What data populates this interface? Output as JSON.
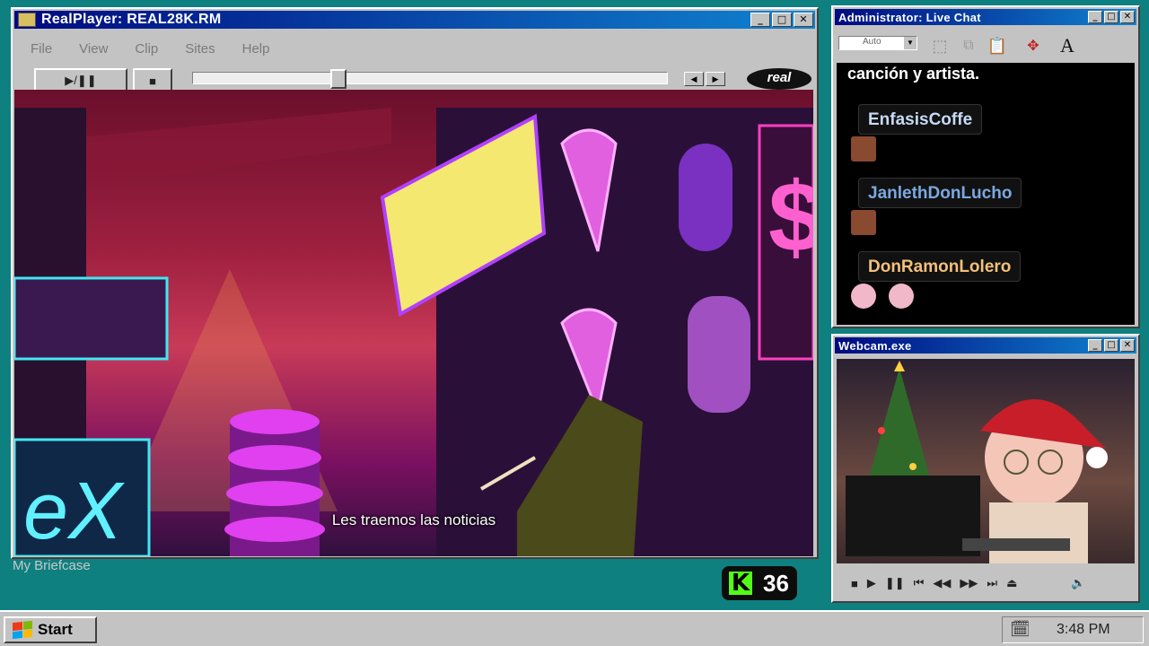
{
  "realplayer": {
    "title": "RealPlayer: REAL28K.RM",
    "menu": [
      "File",
      "View",
      "Clip",
      "Sites",
      "Help"
    ],
    "play_pause_label": "▶/❚❚",
    "stop_label": "■",
    "logo_text": "real",
    "seek_progress": 0.3,
    "subtitle": "Les traemos las noticias"
  },
  "chat": {
    "title": "Administrator: Live Chat",
    "font_size_value": "Auto",
    "message_text": "canción y artista.",
    "users": [
      {
        "name": "EnfasisCoffe",
        "color": "#c6daf5"
      },
      {
        "name": "JanlethDonLucho",
        "color": "#7aa8e0"
      },
      {
        "name": "DonRamonLolero",
        "color": "#f3c07a"
      }
    ],
    "text_tool_label": "A"
  },
  "webcam": {
    "title": "Webcam.exe",
    "controls": [
      "■",
      "▶",
      "❚❚",
      "⏮",
      "◀◀",
      "▶▶",
      "⏭",
      "⏏",
      "🔈"
    ]
  },
  "desktop": {
    "briefcase_label": "My Briefcase",
    "kick_viewers": "36",
    "kick_logo": "K"
  },
  "taskbar": {
    "start_label": "Start",
    "clock": "3:48 PM"
  },
  "title_buttons": [
    "_",
    "□",
    "✕"
  ]
}
